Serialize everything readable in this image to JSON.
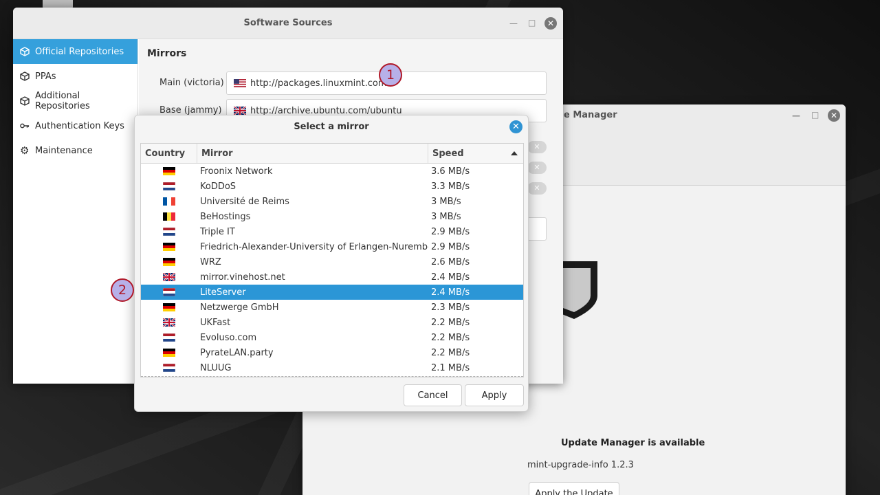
{
  "software_sources": {
    "title": "Software Sources",
    "sidebar": [
      {
        "label": "Official Repositories",
        "icon": "package-icon"
      },
      {
        "label": "PPAs",
        "icon": "package-icon"
      },
      {
        "label": "Additional Repositories",
        "icon": "package-icon"
      },
      {
        "label": "Authentication Keys",
        "icon": "key-icon"
      },
      {
        "label": "Maintenance",
        "icon": "gear-icon"
      }
    ],
    "mirrors_heading": "Mirrors",
    "main_label": "Main (victoria)",
    "main_url": "http://packages.linuxmint.com",
    "base_label": "Base (jammy)",
    "base_url": "http://archive.ubuntu.com/ubuntu"
  },
  "update_manager": {
    "title_fragment": "e Manager",
    "message": "Update Manager is available",
    "package": "mint-upgrade-info 1.2.3",
    "apply_button": "Apply the Update"
  },
  "dialog": {
    "title": "Select a mirror",
    "columns": {
      "country": "Country",
      "mirror": "Mirror",
      "speed": "Speed"
    },
    "rows": [
      {
        "flag": "de",
        "mirror": "Froonix Network",
        "speed": "3.6 MB/s"
      },
      {
        "flag": "nl",
        "mirror": "KoDDoS",
        "speed": "3.3 MB/s"
      },
      {
        "flag": "fr",
        "mirror": "Université de Reims",
        "speed": "3 MB/s"
      },
      {
        "flag": "be",
        "mirror": "BeHostings",
        "speed": "3 MB/s"
      },
      {
        "flag": "nl",
        "mirror": "Triple IT",
        "speed": "2.9 MB/s"
      },
      {
        "flag": "de",
        "mirror": "Friedrich-Alexander-University of Erlangen-Nuremberg",
        "speed": "2.9 MB/s"
      },
      {
        "flag": "de",
        "mirror": "WRZ",
        "speed": "2.6 MB/s"
      },
      {
        "flag": "gb",
        "mirror": "mirror.vinehost.net",
        "speed": "2.4 MB/s"
      },
      {
        "flag": "nl",
        "mirror": "LiteServer",
        "speed": "2.4 MB/s",
        "selected": true
      },
      {
        "flag": "de",
        "mirror": "Netzwerge GmbH",
        "speed": "2.3 MB/s"
      },
      {
        "flag": "gb",
        "mirror": "UKFast",
        "speed": "2.2 MB/s"
      },
      {
        "flag": "nl",
        "mirror": "Evoluso.com",
        "speed": "2.2 MB/s"
      },
      {
        "flag": "de",
        "mirror": "PyrateLAN.party",
        "speed": "2.2 MB/s"
      },
      {
        "flag": "nl",
        "mirror": "NLUUG",
        "speed": "2.1 MB/s"
      }
    ],
    "cancel": "Cancel",
    "apply": "Apply"
  },
  "annotations": {
    "badge1": "1",
    "badge2": "2"
  },
  "colors": {
    "accent": "#35a0dc",
    "selection": "#2b96d6",
    "badge_fill": "#b7b0e8",
    "badge_border": "#b01828"
  }
}
